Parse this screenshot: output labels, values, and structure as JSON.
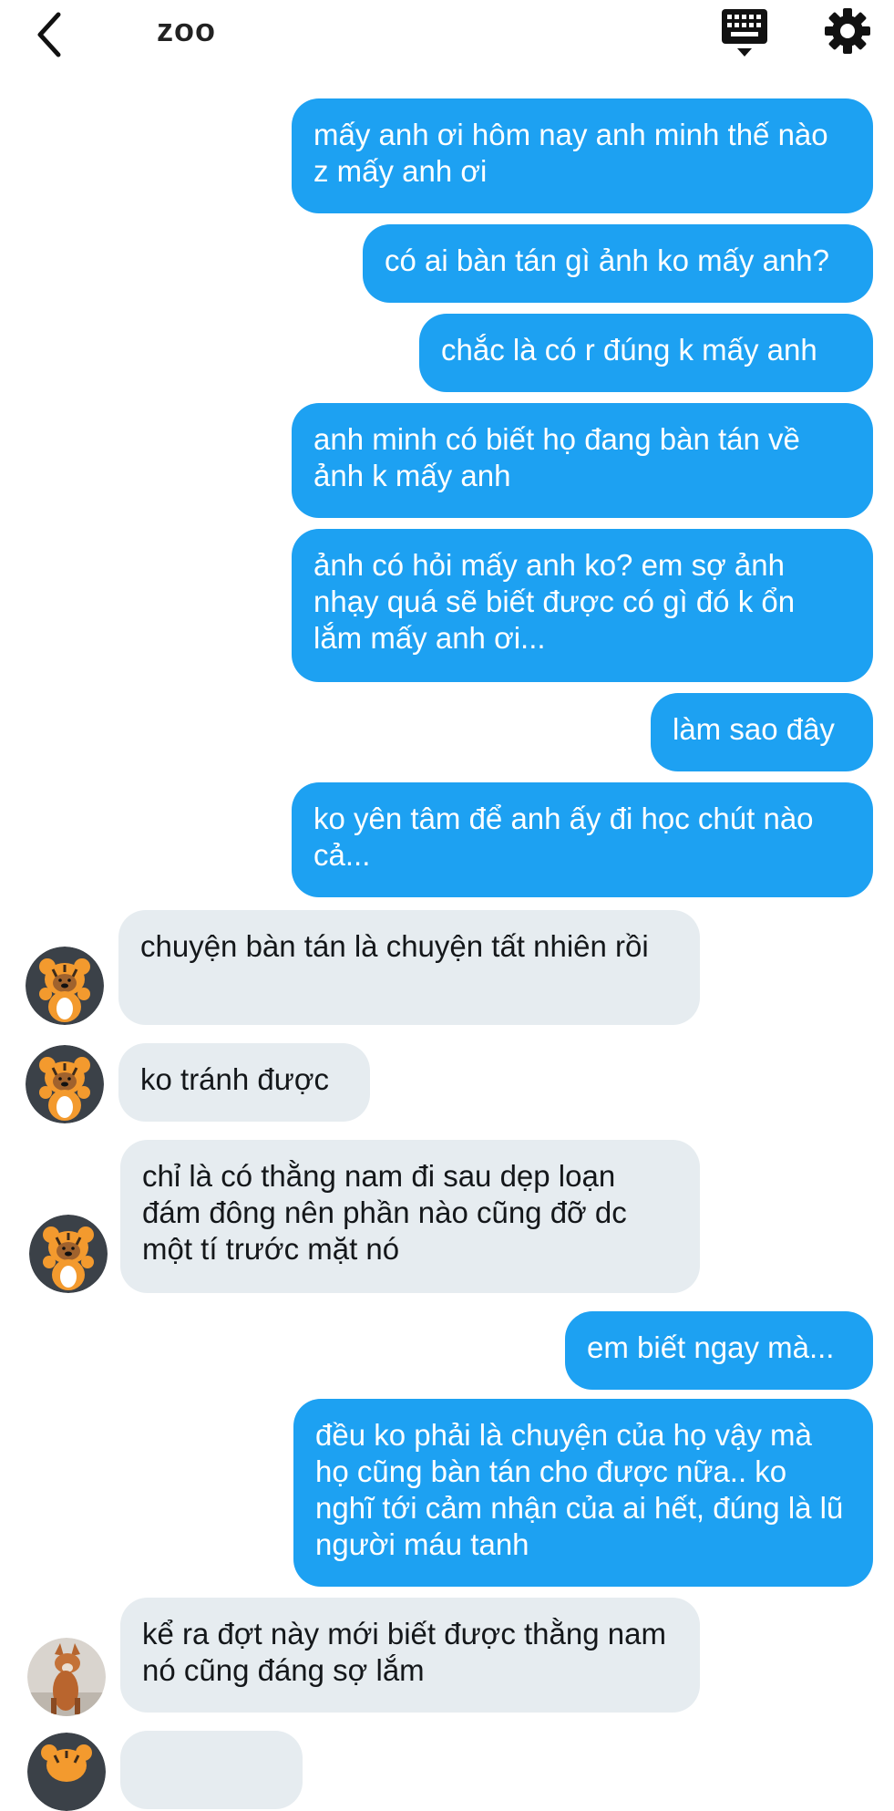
{
  "header": {
    "title": "zoo",
    "back_icon": "chevron-left-icon",
    "keyboard_icon": "keyboard-icon",
    "settings_icon": "gear-icon"
  },
  "colors": {
    "outgoing_bubble": "#1da1f2",
    "incoming_bubble": "#e6ecf0",
    "outgoing_text": "#ffffff",
    "incoming_text": "#14171a"
  },
  "messages": [
    {
      "dir": "out",
      "text": "mấy anh ơi hôm nay anh minh thế nào z mấy anh ơi"
    },
    {
      "dir": "out",
      "text": "có ai bàn tán gì ảnh ko mấy anh?"
    },
    {
      "dir": "out",
      "text": "chắc là có r đúng k mấy anh"
    },
    {
      "dir": "out",
      "text": "anh minh có biết họ đang bàn tán về ảnh k mấy anh"
    },
    {
      "dir": "out",
      "text": "ảnh có hỏi mấy anh ko? em sợ ảnh nhạy quá sẽ biết được có gì đó k ổn lắm mấy anh ơi..."
    },
    {
      "dir": "out",
      "text": "làm sao đây"
    },
    {
      "dir": "out",
      "text": "ko yên tâm để anh ấy đi học chút nào cả..."
    },
    {
      "dir": "in",
      "text": "chuyện bàn tán là chuyện tất nhiên rồi",
      "avatar": "tiger-bear-avatar"
    },
    {
      "dir": "in",
      "text": "ko tránh được",
      "avatar": "tiger-bear-avatar"
    },
    {
      "dir": "in",
      "text": "chỉ là có thằng nam đi sau dẹp loạn đám đông nên phần nào cũng đỡ dc một tí trước mặt nó",
      "avatar": "tiger-bear-avatar"
    },
    {
      "dir": "out",
      "text": "em biết ngay mà..."
    },
    {
      "dir": "out",
      "text": "đều ko phải là chuyện của họ vậy mà họ cũng bàn tán cho được nữa.. ko nghĩ tới cảm nhận của ai hết, đúng là lũ người máu tanh"
    },
    {
      "dir": "in",
      "text": " kể ra đợt này mới biết được thằng nam nó cũng đáng sợ lắm",
      "avatar": "fox-photo-avatar"
    },
    {
      "dir": "in",
      "text": "",
      "avatar": "tiger-bear-avatar"
    }
  ]
}
